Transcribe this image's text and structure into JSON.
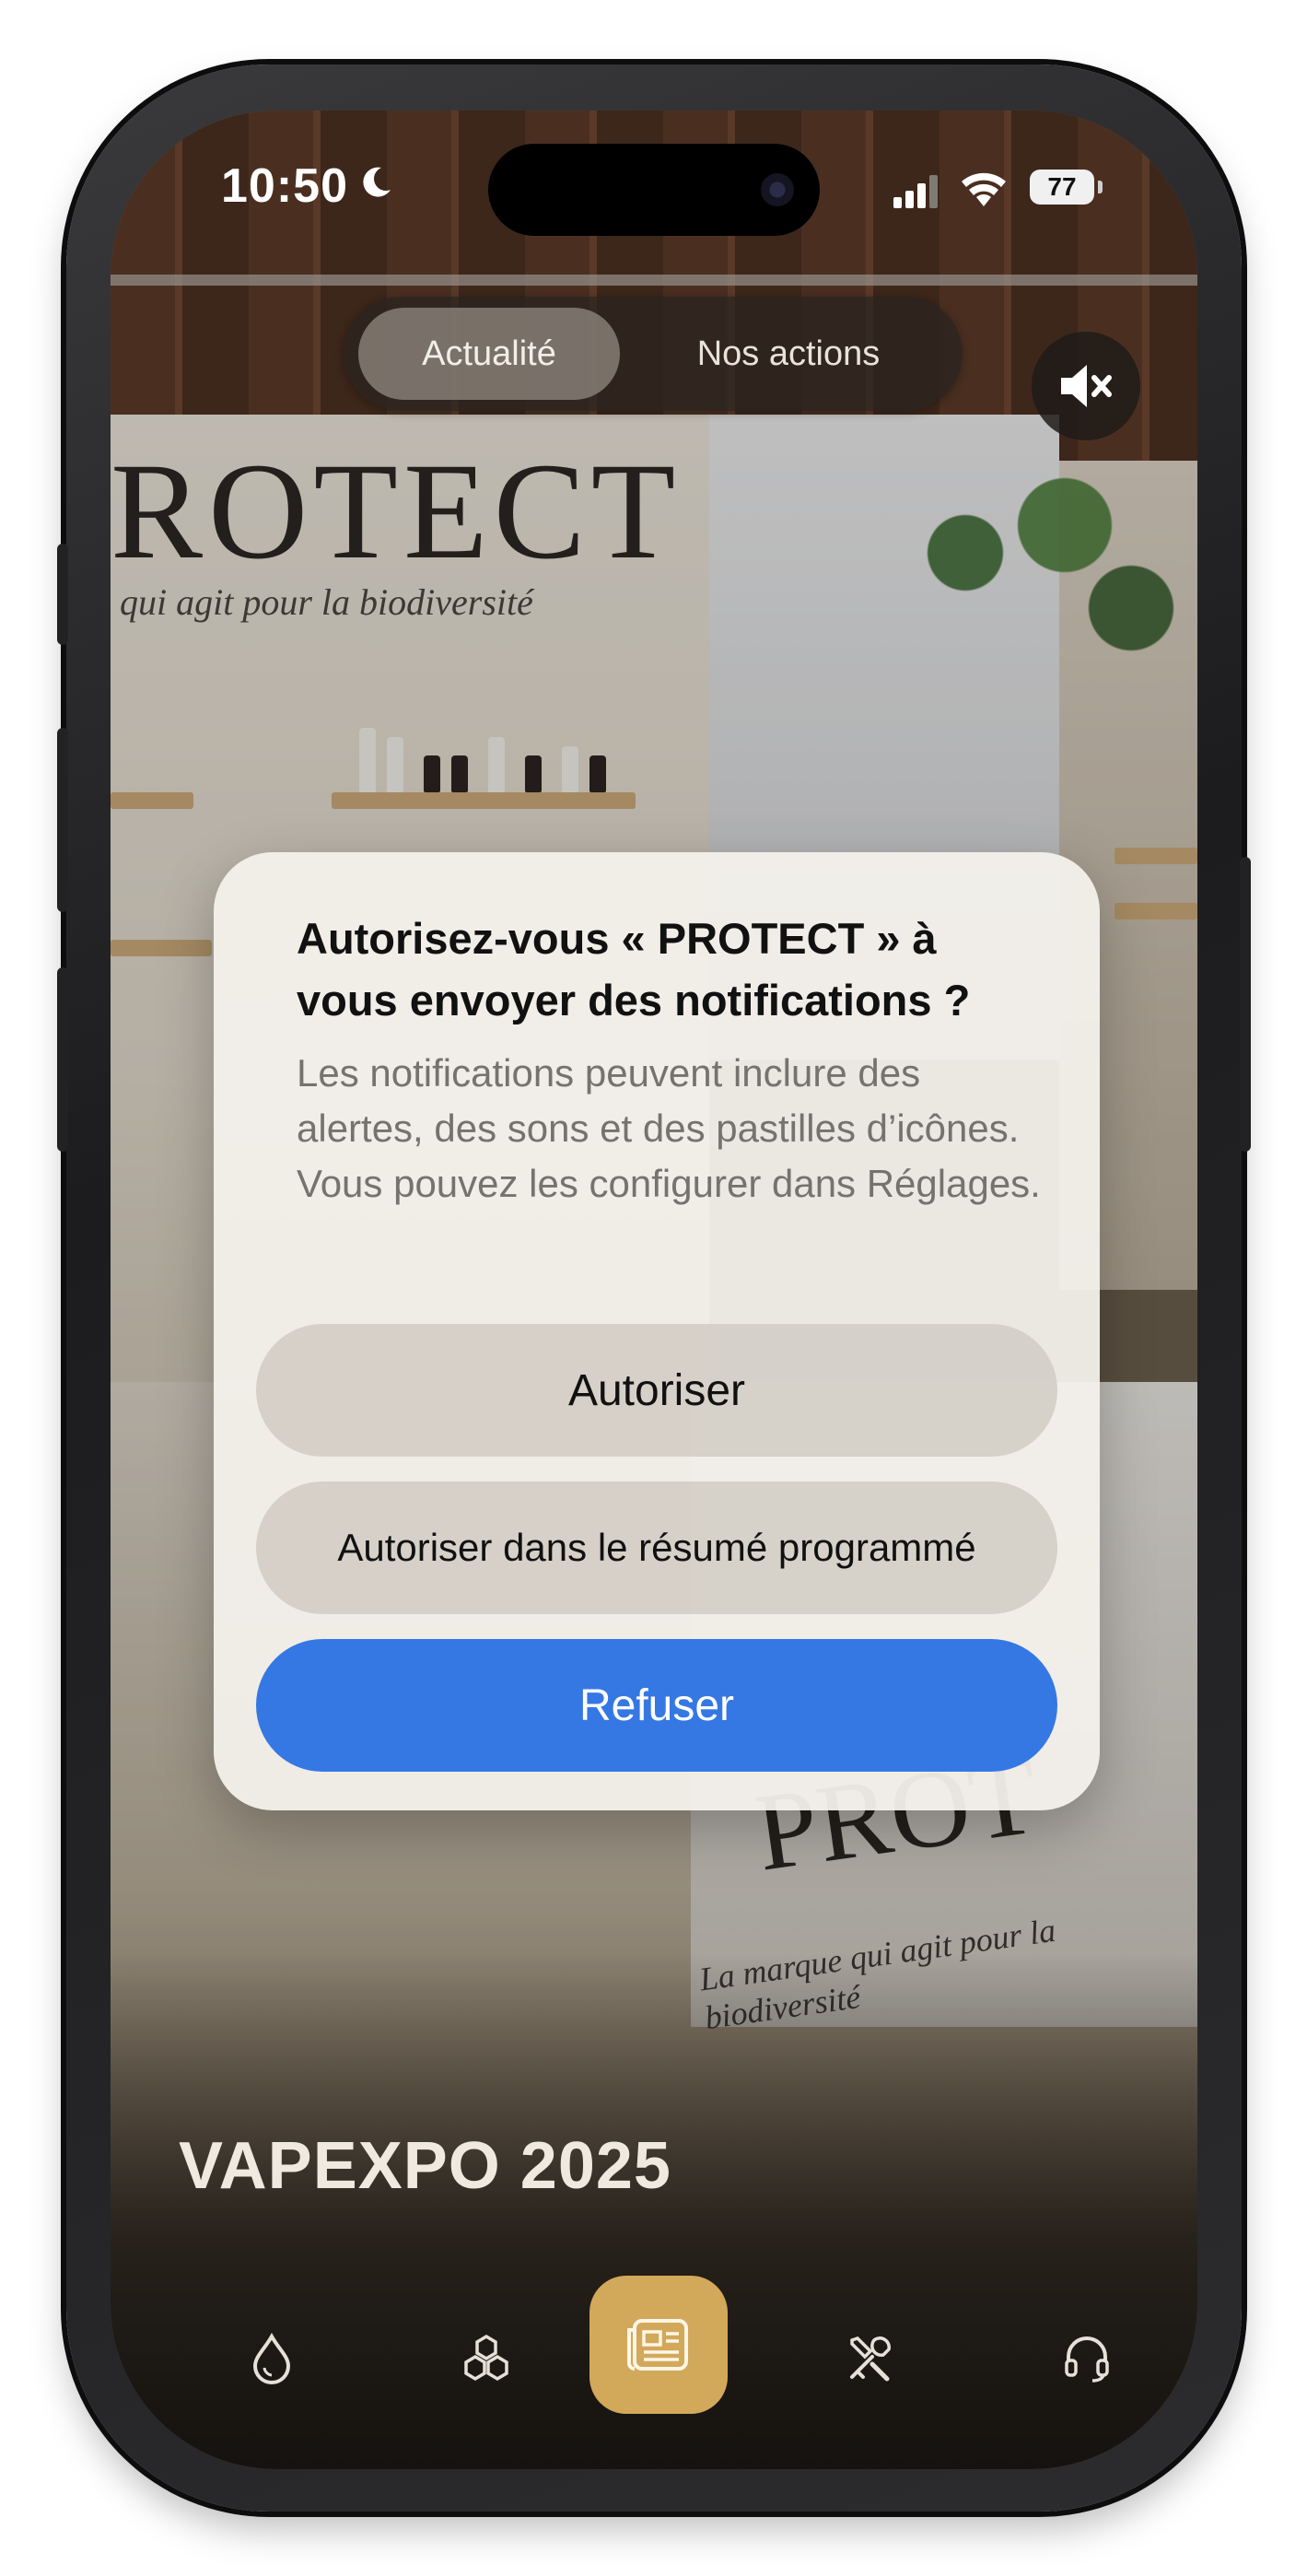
{
  "status_bar": {
    "time": "10:50",
    "battery": "77",
    "icons": [
      "moon-icon",
      "signal-icon",
      "wifi-icon",
      "battery-icon"
    ]
  },
  "background": {
    "brand_text": "ROTECT",
    "brand_tagline": "qui agit pour la biodiversité",
    "counter_brand": "PROT",
    "counter_tagline": "La marque qui agit pour la biodiversité"
  },
  "segmented_control": {
    "tabs": [
      {
        "label": "Actualité",
        "selected": true
      },
      {
        "label": "Nos actions",
        "selected": false
      }
    ]
  },
  "mute_button": {
    "icon": "speaker-muted-icon"
  },
  "alert": {
    "title": "Autorisez-vous « PROTECT » à vous envoyer des notifications ?",
    "message": "Les notifications peuvent inclure des alertes, des sons et des pastilles d’icônes. Vous pouvez les configurer dans Réglages.",
    "buttons": {
      "allow": "Autoriser",
      "summary": "Autoriser dans le résumé programmé",
      "deny": "Refuser"
    },
    "accent_color": "#3578e3"
  },
  "page": {
    "title": "VAPEXPO 2025"
  },
  "tab_bar": {
    "items": [
      {
        "icon": "drop-icon",
        "active": false
      },
      {
        "icon": "hexagons-icon",
        "active": false
      },
      {
        "icon": "newspaper-icon",
        "active": true
      },
      {
        "icon": "tools-icon",
        "active": false
      },
      {
        "icon": "headset-icon",
        "active": false
      }
    ],
    "active_color": "#d2a85a"
  }
}
